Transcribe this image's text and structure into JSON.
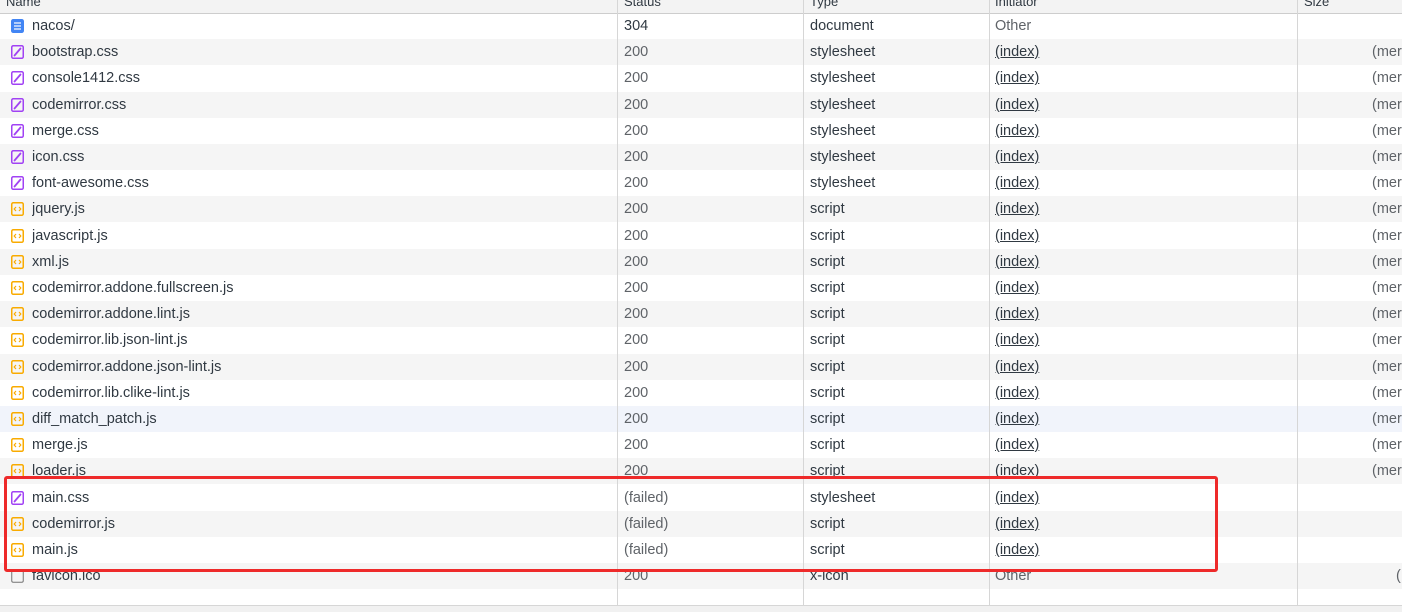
{
  "columns": {
    "name": "Name",
    "status": "Status",
    "type": "Type",
    "initiator": "Initiator",
    "size": "Size"
  },
  "icon_colors": {
    "document": "#4285f4",
    "stylesheet": "#a142f4",
    "script": "#f9ab00",
    "other": "#757575"
  },
  "rows": [
    {
      "name": "nacos/",
      "status": "304",
      "type": "document",
      "initiator": "Other",
      "size": "",
      "icon": "document-icon"
    },
    {
      "name": "bootstrap.css",
      "status": "200",
      "type": "stylesheet",
      "initiator": "(index)",
      "size": "(mer",
      "icon": "stylesheet-icon"
    },
    {
      "name": "console1412.css",
      "status": "200",
      "type": "stylesheet",
      "initiator": "(index)",
      "size": "(mer",
      "icon": "stylesheet-icon"
    },
    {
      "name": "codemirror.css",
      "status": "200",
      "type": "stylesheet",
      "initiator": "(index)",
      "size": "(mer",
      "icon": "stylesheet-icon"
    },
    {
      "name": "merge.css",
      "status": "200",
      "type": "stylesheet",
      "initiator": "(index)",
      "size": "(mer",
      "icon": "stylesheet-icon"
    },
    {
      "name": "icon.css",
      "status": "200",
      "type": "stylesheet",
      "initiator": "(index)",
      "size": "(mer",
      "icon": "stylesheet-icon"
    },
    {
      "name": "font-awesome.css",
      "status": "200",
      "type": "stylesheet",
      "initiator": "(index)",
      "size": "(mer",
      "icon": "stylesheet-icon"
    },
    {
      "name": "jquery.js",
      "status": "200",
      "type": "script",
      "initiator": "(index)",
      "size": "(mer",
      "icon": "script-icon"
    },
    {
      "name": "javascript.js",
      "status": "200",
      "type": "script",
      "initiator": "(index)",
      "size": "(mer",
      "icon": "script-icon"
    },
    {
      "name": "xml.js",
      "status": "200",
      "type": "script",
      "initiator": "(index)",
      "size": "(mer",
      "icon": "script-icon"
    },
    {
      "name": "codemirror.addone.fullscreen.js",
      "status": "200",
      "type": "script",
      "initiator": "(index)",
      "size": "(mer",
      "icon": "script-icon"
    },
    {
      "name": "codemirror.addone.lint.js",
      "status": "200",
      "type": "script",
      "initiator": "(index)",
      "size": "(mer",
      "icon": "script-icon"
    },
    {
      "name": "codemirror.lib.json-lint.js",
      "status": "200",
      "type": "script",
      "initiator": "(index)",
      "size": "(mer",
      "icon": "script-icon"
    },
    {
      "name": "codemirror.addone.json-lint.js",
      "status": "200",
      "type": "script",
      "initiator": "(index)",
      "size": "(mer",
      "icon": "script-icon"
    },
    {
      "name": "codemirror.lib.clike-lint.js",
      "status": "200",
      "type": "script",
      "initiator": "(index)",
      "size": "(mer",
      "icon": "script-icon"
    },
    {
      "name": "diff_match_patch.js",
      "status": "200",
      "type": "script",
      "initiator": "(index)",
      "size": "(mer",
      "icon": "script-icon"
    },
    {
      "name": "merge.js",
      "status": "200",
      "type": "script",
      "initiator": "(index)",
      "size": "(mer",
      "icon": "script-icon"
    },
    {
      "name": "loader.js",
      "status": "200",
      "type": "script",
      "initiator": "(index)",
      "size": "(mer",
      "icon": "script-icon"
    },
    {
      "name": "main.css",
      "status": "(failed)",
      "type": "stylesheet",
      "initiator": "(index)",
      "size": "",
      "icon": "stylesheet-icon"
    },
    {
      "name": "codemirror.js",
      "status": "(failed)",
      "type": "script",
      "initiator": "(index)",
      "size": "",
      "icon": "script-icon"
    },
    {
      "name": "main.js",
      "status": "(failed)",
      "type": "script",
      "initiator": "(index)",
      "size": "",
      "icon": "script-icon"
    },
    {
      "name": "favicon.ico",
      "status": "200",
      "type": "x-icon",
      "initiator": "Other",
      "size": "(",
      "icon": "file-icon"
    }
  ],
  "annotation": {
    "color": "#ee2a2a"
  }
}
